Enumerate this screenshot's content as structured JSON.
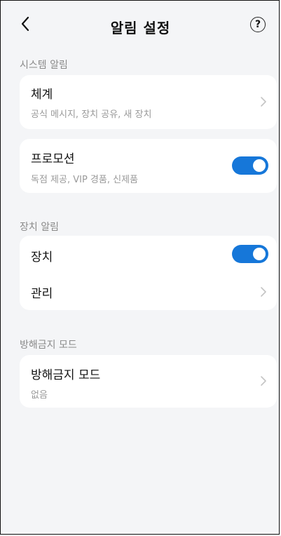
{
  "header": {
    "title": "알림 설정",
    "help_label": "?"
  },
  "sections": {
    "system": {
      "title": "시스템 알림",
      "system_item": {
        "title": "체계",
        "subtitle": "공식 메시지, 장치 공유, 새 장치"
      },
      "promo_item": {
        "title": "프로모션",
        "subtitle": "독점 제공, VIP 경품, 신제품",
        "toggle_on": true
      }
    },
    "device": {
      "title": "장치 알림",
      "device_item": {
        "title": "장치",
        "toggle_on": true
      },
      "manage_item": {
        "title": "관리"
      }
    },
    "dnd": {
      "title": "방해금지 모드",
      "dnd_item": {
        "title": "방해금지 모드",
        "subtitle": "없음"
      }
    }
  },
  "colors": {
    "accent": "#1677d9",
    "background": "#f4f5f7",
    "card": "#ffffff"
  },
  "icons": {
    "back": "chevron-left-icon",
    "help": "help-circle-icon",
    "chevron": "chevron-right-icon"
  }
}
